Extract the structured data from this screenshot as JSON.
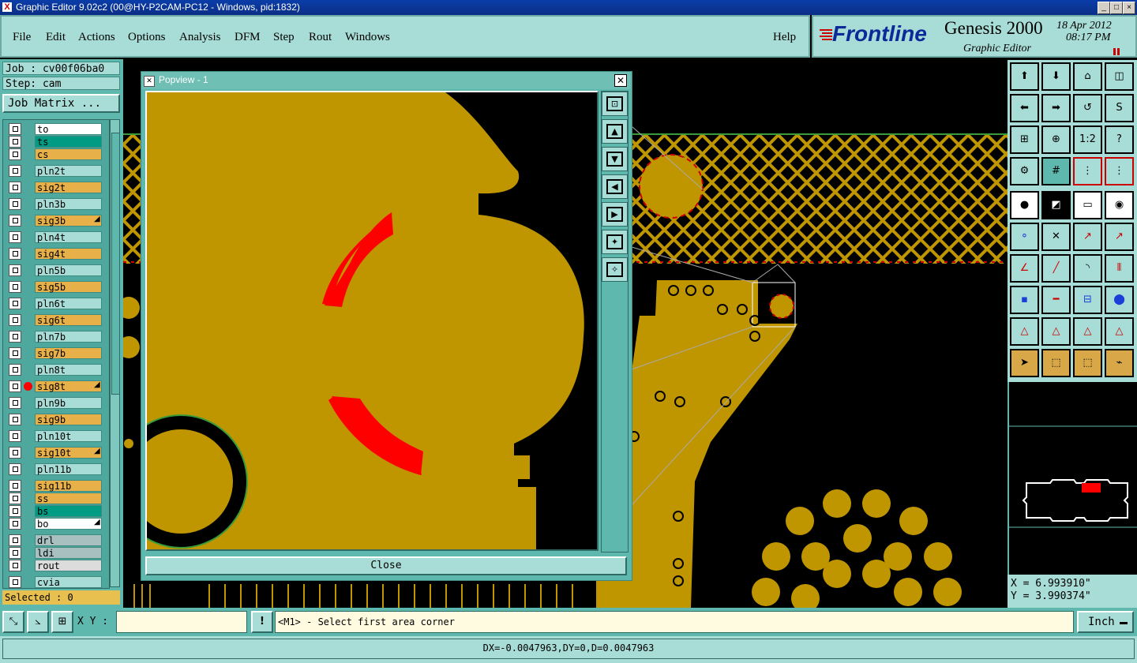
{
  "window": {
    "title": "Graphic Editor 9.02c2 (00@HY-P2CAM-PC12 - Windows, pid:1832)"
  },
  "menu": {
    "items": [
      "File",
      "Edit",
      "Actions",
      "Options",
      "Analysis",
      "DFM",
      "Step",
      "Rout",
      "Windows"
    ],
    "help": "Help"
  },
  "brand": {
    "logo": "Frontline",
    "product": "Genesis 2000",
    "subtitle": "Graphic Editor",
    "date": "18 Apr 2012",
    "time": "08:17 PM"
  },
  "job": {
    "job_label": "Job : cv00f06ba0",
    "step_label": "Step: cam",
    "matrix_button": "Job Matrix ..."
  },
  "layers": [
    {
      "name": "to",
      "color": "#ffffff"
    },
    {
      "name": "ts",
      "color": "#009b83"
    },
    {
      "name": "cs",
      "color": "#e8b048"
    },
    {
      "name": "pln2t",
      "color": "#a8dcd6"
    },
    {
      "name": "sig2t",
      "color": "#e8b048"
    },
    {
      "name": "pln3b",
      "color": "#a8dcd6"
    },
    {
      "name": "sig3b",
      "color": "#e8b048",
      "mark": true
    },
    {
      "name": "pln4t",
      "color": "#a8dcd6"
    },
    {
      "name": "sig4t",
      "color": "#e8b048"
    },
    {
      "name": "pln5b",
      "color": "#a8dcd6"
    },
    {
      "name": "sig5b",
      "color": "#e8b048"
    },
    {
      "name": "pln6t",
      "color": "#a8dcd6"
    },
    {
      "name": "sig6t",
      "color": "#e8b048"
    },
    {
      "name": "pln7b",
      "color": "#a8dcd6"
    },
    {
      "name": "sig7b",
      "color": "#e8b048"
    },
    {
      "name": "pln8t",
      "color": "#a8dcd6"
    },
    {
      "name": "sig8t",
      "color": "#e8b048",
      "mark": true,
      "active": true
    },
    {
      "name": "pln9b",
      "color": "#a8dcd6"
    },
    {
      "name": "sig9b",
      "color": "#e8b048"
    },
    {
      "name": "pln10t",
      "color": "#a8dcd6"
    },
    {
      "name": "sig10t",
      "color": "#e8b048",
      "mark": true
    },
    {
      "name": "pln11b",
      "color": "#a8dcd6"
    },
    {
      "name": "sig11b",
      "color": "#e8b048"
    },
    {
      "name": "ss",
      "color": "#e8b048"
    },
    {
      "name": "bs",
      "color": "#009b83"
    },
    {
      "name": "bo",
      "color": "#ffffff",
      "mark": true
    },
    {
      "name": "drl",
      "color": "#a8c0c0"
    },
    {
      "name": "ldi",
      "color": "#a8c0c0"
    },
    {
      "name": "rout",
      "color": "#dcdcdc"
    },
    {
      "name": "cvia",
      "color": "#a8dcd6"
    }
  ],
  "selected": "Selected : 0",
  "popview": {
    "title": "Popview - 1",
    "close_label": "Close"
  },
  "command": {
    "xy_label": "X Y :",
    "xy_value": "",
    "prompt": "<M1> - Select first area corner",
    "unit": "Inch"
  },
  "coords": {
    "x": "X = 6.993910\"",
    "y": "Y = 3.990374\""
  },
  "status": "DX=-0.0047963,DY=0,D=0.0047963",
  "colors": {
    "copper": "#c09600",
    "panel": "#a8dcd6",
    "panel_dark": "#5fb8ad",
    "highlight": "#ff0000"
  }
}
